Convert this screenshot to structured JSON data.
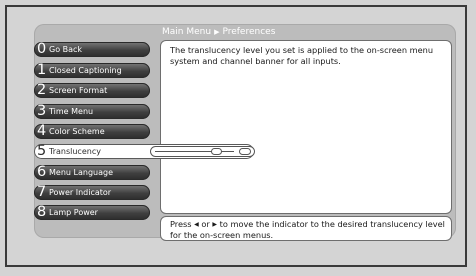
{
  "breadcrumb": {
    "parent": "Main Menu",
    "separator": "▶",
    "current": "Preferences"
  },
  "menu": {
    "items": [
      {
        "number": "0",
        "label": "Go Back"
      },
      {
        "number": "1",
        "label": "Closed Captioning"
      },
      {
        "number": "2",
        "label": "Screen Format"
      },
      {
        "number": "3",
        "label": "Time Menu"
      },
      {
        "number": "4",
        "label": "Color Scheme"
      },
      {
        "number": "5",
        "label": "Translucency",
        "selected": true
      },
      {
        "number": "6",
        "label": "Menu Language"
      },
      {
        "number": "7",
        "label": "Power Indicator"
      },
      {
        "number": "8",
        "label": "Lamp Power"
      }
    ]
  },
  "content": {
    "description": "The translucency level you set is applied to the on-screen menu system and channel banner for all inputs."
  },
  "translucency_slider": {
    "level": 0.82
  },
  "help": {
    "prefix": "Press",
    "left_arrow": "◀",
    "or": "or",
    "right_arrow": "▶",
    "suffix": "to move the indicator to the desired translucency level for the on-screen menus."
  }
}
